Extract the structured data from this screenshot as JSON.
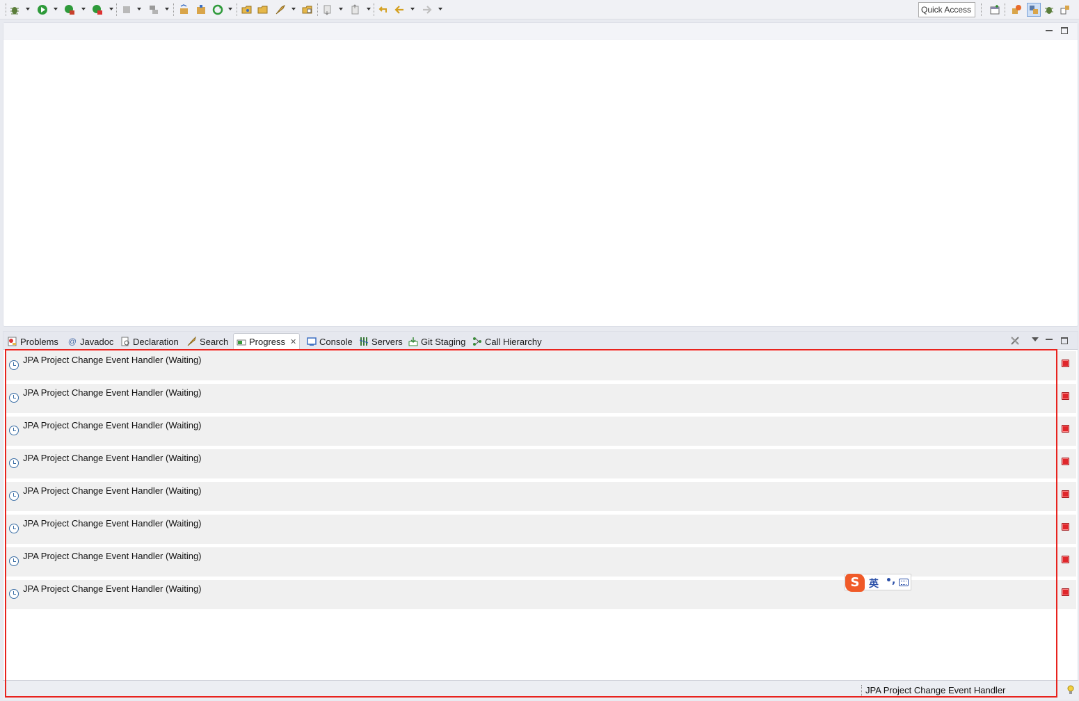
{
  "toolbar": {
    "quick_access_label": "Quick Access",
    "icons": [
      "debug-icon",
      "run-icon",
      "coverage-icon",
      "external-tools-icon",
      "stop-icon",
      "build-icon",
      "new-java-package-icon",
      "new-class-icon",
      "refresh-icon",
      "open-type-icon",
      "open-folder-icon",
      "open-task-icon",
      "open-resource-icon",
      "next-annotation-icon",
      "prev-annotation-icon",
      "last-edit-icon",
      "back-icon",
      "forward-icon"
    ],
    "perspective_icons": [
      "open-perspective-icon",
      "java-ee-perspective-icon",
      "java-perspective-icon",
      "debug-perspective-icon",
      "git-perspective-icon"
    ]
  },
  "views": {
    "tabs": [
      {
        "label": "Problems",
        "icon": "problems-icon"
      },
      {
        "label": "Javadoc",
        "icon": "javadoc-icon"
      },
      {
        "label": "Declaration",
        "icon": "declaration-icon"
      },
      {
        "label": "Search",
        "icon": "search-icon"
      },
      {
        "label": "Progress",
        "icon": "progress-icon",
        "active": true,
        "close": "✕"
      },
      {
        "label": "Console",
        "icon": "console-icon"
      },
      {
        "label": "Servers",
        "icon": "servers-icon"
      },
      {
        "label": "Git Staging",
        "icon": "git-staging-icon"
      },
      {
        "label": "Call Hierarchy",
        "icon": "call-hierarchy-icon"
      }
    ],
    "progress_items": [
      {
        "label": "JPA Project Change Event Handler (Waiting)"
      },
      {
        "label": "JPA Project Change Event Handler (Waiting)"
      },
      {
        "label": "JPA Project Change Event Handler (Waiting)"
      },
      {
        "label": "JPA Project Change Event Handler (Waiting)"
      },
      {
        "label": "JPA Project Change Event Handler (Waiting)"
      },
      {
        "label": "JPA Project Change Event Handler (Waiting)"
      },
      {
        "label": "JPA Project Change Event Handler (Waiting)"
      },
      {
        "label": "JPA Project Change Event Handler (Waiting)"
      }
    ]
  },
  "status_bar": {
    "text": "JPA Project Change Event Handler"
  },
  "ime": {
    "logo": "S",
    "lang": "英",
    "punct": "•,"
  },
  "colors": {
    "highlight": "#e8231e",
    "stop_button": "#e0262b",
    "row_background": "#f0f0f0"
  }
}
